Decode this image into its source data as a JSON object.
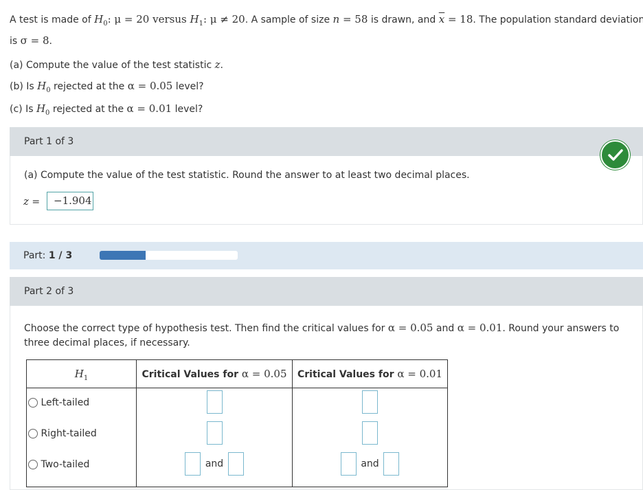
{
  "problem": {
    "t1": "A test is made of ",
    "h0": "H",
    "h0_sub": "0",
    "colon_mu": ": μ = 20 versus ",
    "h1": "H",
    "h1_sub": "1",
    "colon_mu2": ": μ ≠ 20",
    "t2": ". A sample of size ",
    "n": "n",
    "n_eq": " = 58",
    "t3": " is drawn, and ",
    "xbar": "x",
    "xbar_eq": " = 18",
    "t4": ". The population standard deviation",
    "line2_pre": "is ",
    "sigma": "σ = 8",
    "line2_post": "."
  },
  "questions": {
    "a_pre": "(a) Compute the value of the test statistic ",
    "a_var": "z",
    "a_post": ".",
    "b_pre": "(b) Is ",
    "b_H": "H",
    "b_sub": "0",
    "b_mid": " rejected at the ",
    "b_alpha": "α = 0.05",
    "b_post": " level?",
    "c_pre": "(c) Is ",
    "c_H": "H",
    "c_sub": "0",
    "c_mid": " rejected at the ",
    "c_alpha": "α = 0.01",
    "c_post": " level?"
  },
  "part1": {
    "header": "Part 1 of 3",
    "prompt": "(a) Compute the value of the test statistic. Round the answer to at least two decimal places.",
    "z_label": "z",
    "eq": " =",
    "answer": "−1.904",
    "status": "correct"
  },
  "progress": {
    "label": "Part: ",
    "current": "1",
    "sep": " / ",
    "total": "3",
    "fraction": 0.333
  },
  "part2": {
    "header": "Part 2 of 3",
    "prompt_l1_pre": "Choose the correct type of hypothesis test. Then find the critical values for ",
    "prompt_a1": "α = 0.05",
    "prompt_and": " and ",
    "prompt_a2": "α = 0.01",
    "prompt_l1_post": ". Round your answers to",
    "prompt_l2": "three decimal places, if necessary.",
    "table": {
      "col1_H": "H",
      "col1_sub": "1",
      "col2_pre": "Critical Values for ",
      "col2_alpha": "α = 0.05",
      "col3_pre": "Critical Values for ",
      "col3_alpha": "α = 0.01",
      "rows": [
        {
          "label": "Left-tailed"
        },
        {
          "label": "Right-tailed"
        },
        {
          "label": "Two-tailed",
          "and": "and"
        }
      ]
    }
  },
  "colors": {
    "correct": "#2e8b3a",
    "progress": "#3d76b5",
    "header_bg": "#d9dee2"
  }
}
